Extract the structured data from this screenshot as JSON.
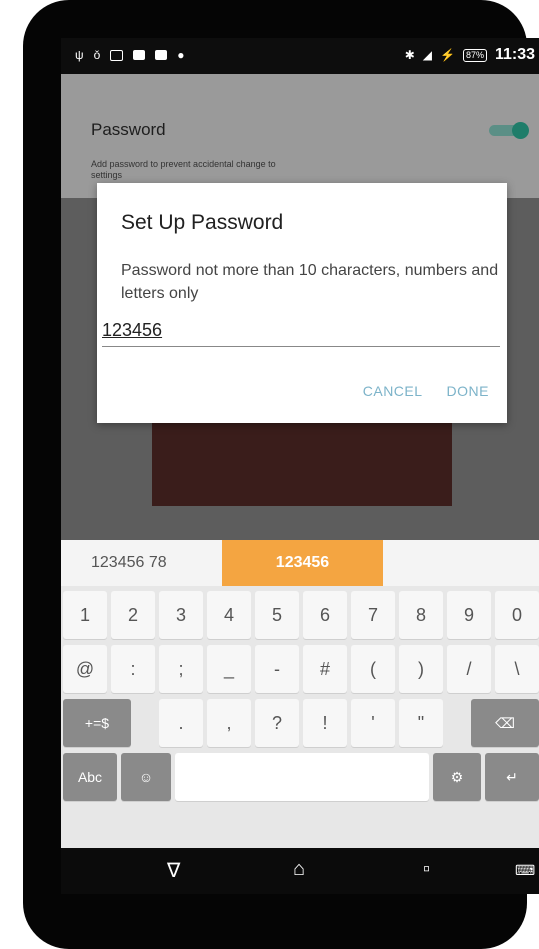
{
  "status_bar": {
    "left_icons": [
      "usb-icon",
      "record-icon",
      "image-icon",
      "voicemail-icon",
      "photo-icon",
      "location-icon"
    ],
    "battery": "87%",
    "time": "11:33"
  },
  "settings": {
    "title": "Password",
    "subtitle": "Add password to prevent accidental change to settings"
  },
  "dialog": {
    "title": "Set Up Password",
    "message": "Password not more than 10 characters, numbers and letters only",
    "input_value": "123456",
    "cancel_label": "CANCEL",
    "done_label": "DONE"
  },
  "suggestions": {
    "left": "123456 78",
    "highlighted": "123456"
  },
  "keyboard": {
    "row1": [
      "1",
      "2",
      "3",
      "4",
      "5",
      "6",
      "7",
      "8",
      "9",
      "0"
    ],
    "row2": [
      "@",
      ":",
      ";",
      "_",
      "-",
      "#",
      "(",
      ")",
      "/",
      "\\"
    ],
    "row3": {
      "mode": "+=$",
      "keys": [
        ".",
        ",",
        "?",
        "!",
        "'",
        "\""
      ]
    },
    "row4": {
      "abc": "Abc"
    }
  },
  "colors": {
    "accent": "#f4a541",
    "toggle": "#1f7d6a",
    "dialog_button": "#7cb3c9"
  }
}
